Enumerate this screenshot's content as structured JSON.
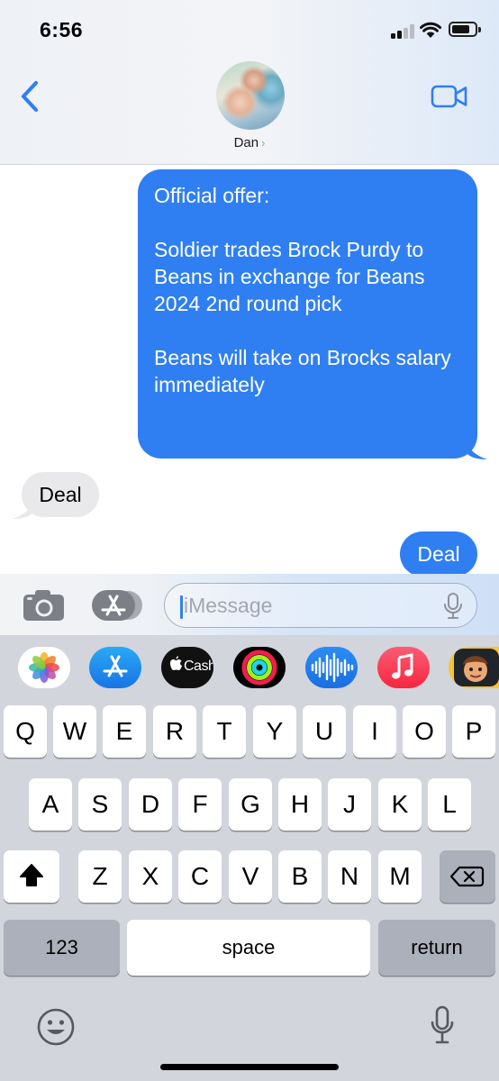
{
  "status_bar": {
    "time": "6:56"
  },
  "header": {
    "contact_name": "Dan",
    "name_chevron": "›",
    "icons": {
      "back": "back-chevron-icon",
      "video": "video-camera-icon"
    },
    "accent_color": "#2f7ff2"
  },
  "messages": [
    {
      "direction": "sent",
      "text": "Official offer:\n\nSoldier trades Brock Purdy to Beans in exchange for Beans 2024 2nd round pick\n\nBeans will take on Brocks salary immediately"
    },
    {
      "direction": "received",
      "text": "Deal"
    },
    {
      "direction": "sent",
      "text": "Deal"
    }
  ],
  "input_bar": {
    "placeholder": "iMessage",
    "icons": {
      "camera": "camera-icon",
      "apps": "app-store-icon",
      "mic": "microphone-icon"
    }
  },
  "app_strip": [
    "photos-icon",
    "app-store-icon",
    "apple-cash-icon",
    "fitness-rings-icon",
    "audio-message-icon",
    "music-icon",
    "memoji-icon"
  ],
  "app_strip_labels": {
    "cash": "Cash"
  },
  "keyboard": {
    "row1": [
      "Q",
      "W",
      "E",
      "R",
      "T",
      "Y",
      "U",
      "I",
      "O",
      "P"
    ],
    "row2": [
      "A",
      "S",
      "D",
      "F",
      "G",
      "H",
      "J",
      "K",
      "L"
    ],
    "row3": [
      "Z",
      "X",
      "C",
      "V",
      "B",
      "N",
      "M"
    ],
    "numbers_label": "123",
    "space_label": "space",
    "return_label": "return",
    "icons": {
      "shift": "shift-icon",
      "delete": "delete-icon",
      "emoji": "emoji-icon",
      "dictation": "microphone-icon"
    }
  }
}
